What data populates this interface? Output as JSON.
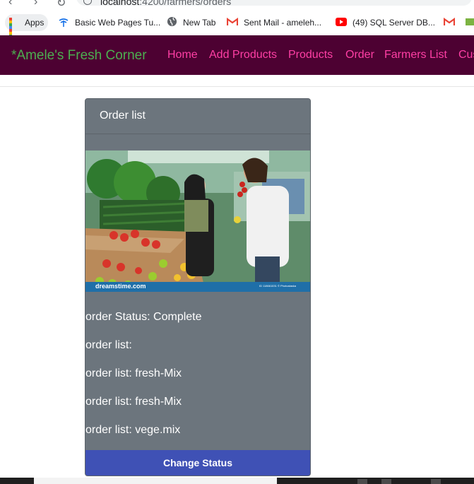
{
  "browser": {
    "url_host": "localhost",
    "url_path": ":4200/farmers/orders",
    "bookmarks": [
      {
        "label": "Apps",
        "icon": "apps-grid-icon"
      },
      {
        "label": "Basic Web Pages Tu...",
        "icon": "bookmark-logo-icon"
      },
      {
        "label": "New Tab",
        "icon": "globe-icon"
      },
      {
        "label": "Sent Mail - ameleh...",
        "icon": "gmail-icon"
      },
      {
        "label": "(49) SQL Server DB...",
        "icon": "youtube-icon"
      }
    ]
  },
  "navbar": {
    "brand": "*Amele's Fresh Corner",
    "links": [
      "Home",
      "Add Products",
      "Products",
      "Order",
      "Farmers List",
      "Cus"
    ]
  },
  "card": {
    "header": "Order list",
    "image_caption": "dreamstime.com",
    "image_id_text": "ID 118661031 © Photoalaska",
    "lines": [
      "order Status: Complete",
      "order list:",
      "order list: fresh-Mix",
      "order list: fresh-Mix",
      "order list: vege.mix"
    ],
    "button": "Change Status"
  },
  "colors": {
    "navbar_bg": "#4d0132",
    "brand": "#4caf50",
    "nav_link": "#ff3fa5",
    "card_bg": "#6c757d",
    "button_bg": "#3f51b5"
  }
}
